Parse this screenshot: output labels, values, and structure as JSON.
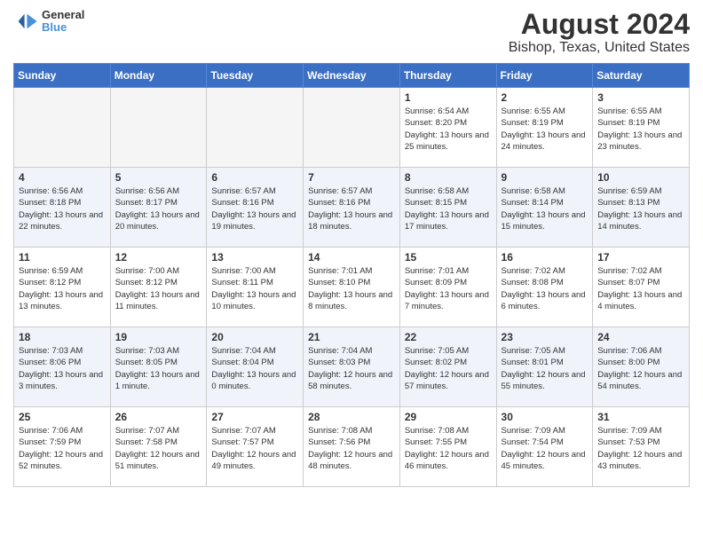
{
  "logo": {
    "line1": "General",
    "line2": "Blue"
  },
  "title": "August 2024",
  "subtitle": "Bishop, Texas, United States",
  "days_of_week": [
    "Sunday",
    "Monday",
    "Tuesday",
    "Wednesday",
    "Thursday",
    "Friday",
    "Saturday"
  ],
  "weeks": [
    [
      {
        "num": "",
        "info": "",
        "empty": true
      },
      {
        "num": "",
        "info": "",
        "empty": true
      },
      {
        "num": "",
        "info": "",
        "empty": true
      },
      {
        "num": "",
        "info": "",
        "empty": true
      },
      {
        "num": "1",
        "info": "Sunrise: 6:54 AM\nSunset: 8:20 PM\nDaylight: 13 hours\nand 25 minutes.",
        "empty": false
      },
      {
        "num": "2",
        "info": "Sunrise: 6:55 AM\nSunset: 8:19 PM\nDaylight: 13 hours\nand 24 minutes.",
        "empty": false
      },
      {
        "num": "3",
        "info": "Sunrise: 6:55 AM\nSunset: 8:19 PM\nDaylight: 13 hours\nand 23 minutes.",
        "empty": false
      }
    ],
    [
      {
        "num": "4",
        "info": "Sunrise: 6:56 AM\nSunset: 8:18 PM\nDaylight: 13 hours\nand 22 minutes.",
        "empty": false
      },
      {
        "num": "5",
        "info": "Sunrise: 6:56 AM\nSunset: 8:17 PM\nDaylight: 13 hours\nand 20 minutes.",
        "empty": false
      },
      {
        "num": "6",
        "info": "Sunrise: 6:57 AM\nSunset: 8:16 PM\nDaylight: 13 hours\nand 19 minutes.",
        "empty": false
      },
      {
        "num": "7",
        "info": "Sunrise: 6:57 AM\nSunset: 8:16 PM\nDaylight: 13 hours\nand 18 minutes.",
        "empty": false
      },
      {
        "num": "8",
        "info": "Sunrise: 6:58 AM\nSunset: 8:15 PM\nDaylight: 13 hours\nand 17 minutes.",
        "empty": false
      },
      {
        "num": "9",
        "info": "Sunrise: 6:58 AM\nSunset: 8:14 PM\nDaylight: 13 hours\nand 15 minutes.",
        "empty": false
      },
      {
        "num": "10",
        "info": "Sunrise: 6:59 AM\nSunset: 8:13 PM\nDaylight: 13 hours\nand 14 minutes.",
        "empty": false
      }
    ],
    [
      {
        "num": "11",
        "info": "Sunrise: 6:59 AM\nSunset: 8:12 PM\nDaylight: 13 hours\nand 13 minutes.",
        "empty": false
      },
      {
        "num": "12",
        "info": "Sunrise: 7:00 AM\nSunset: 8:12 PM\nDaylight: 13 hours\nand 11 minutes.",
        "empty": false
      },
      {
        "num": "13",
        "info": "Sunrise: 7:00 AM\nSunset: 8:11 PM\nDaylight: 13 hours\nand 10 minutes.",
        "empty": false
      },
      {
        "num": "14",
        "info": "Sunrise: 7:01 AM\nSunset: 8:10 PM\nDaylight: 13 hours\nand 8 minutes.",
        "empty": false
      },
      {
        "num": "15",
        "info": "Sunrise: 7:01 AM\nSunset: 8:09 PM\nDaylight: 13 hours\nand 7 minutes.",
        "empty": false
      },
      {
        "num": "16",
        "info": "Sunrise: 7:02 AM\nSunset: 8:08 PM\nDaylight: 13 hours\nand 6 minutes.",
        "empty": false
      },
      {
        "num": "17",
        "info": "Sunrise: 7:02 AM\nSunset: 8:07 PM\nDaylight: 13 hours\nand 4 minutes.",
        "empty": false
      }
    ],
    [
      {
        "num": "18",
        "info": "Sunrise: 7:03 AM\nSunset: 8:06 PM\nDaylight: 13 hours\nand 3 minutes.",
        "empty": false
      },
      {
        "num": "19",
        "info": "Sunrise: 7:03 AM\nSunset: 8:05 PM\nDaylight: 13 hours\nand 1 minute.",
        "empty": false
      },
      {
        "num": "20",
        "info": "Sunrise: 7:04 AM\nSunset: 8:04 PM\nDaylight: 13 hours\nand 0 minutes.",
        "empty": false
      },
      {
        "num": "21",
        "info": "Sunrise: 7:04 AM\nSunset: 8:03 PM\nDaylight: 12 hours\nand 58 minutes.",
        "empty": false
      },
      {
        "num": "22",
        "info": "Sunrise: 7:05 AM\nSunset: 8:02 PM\nDaylight: 12 hours\nand 57 minutes.",
        "empty": false
      },
      {
        "num": "23",
        "info": "Sunrise: 7:05 AM\nSunset: 8:01 PM\nDaylight: 12 hours\nand 55 minutes.",
        "empty": false
      },
      {
        "num": "24",
        "info": "Sunrise: 7:06 AM\nSunset: 8:00 PM\nDaylight: 12 hours\nand 54 minutes.",
        "empty": false
      }
    ],
    [
      {
        "num": "25",
        "info": "Sunrise: 7:06 AM\nSunset: 7:59 PM\nDaylight: 12 hours\nand 52 minutes.",
        "empty": false
      },
      {
        "num": "26",
        "info": "Sunrise: 7:07 AM\nSunset: 7:58 PM\nDaylight: 12 hours\nand 51 minutes.",
        "empty": false
      },
      {
        "num": "27",
        "info": "Sunrise: 7:07 AM\nSunset: 7:57 PM\nDaylight: 12 hours\nand 49 minutes.",
        "empty": false
      },
      {
        "num": "28",
        "info": "Sunrise: 7:08 AM\nSunset: 7:56 PM\nDaylight: 12 hours\nand 48 minutes.",
        "empty": false
      },
      {
        "num": "29",
        "info": "Sunrise: 7:08 AM\nSunset: 7:55 PM\nDaylight: 12 hours\nand 46 minutes.",
        "empty": false
      },
      {
        "num": "30",
        "info": "Sunrise: 7:09 AM\nSunset: 7:54 PM\nDaylight: 12 hours\nand 45 minutes.",
        "empty": false
      },
      {
        "num": "31",
        "info": "Sunrise: 7:09 AM\nSunset: 7:53 PM\nDaylight: 12 hours\nand 43 minutes.",
        "empty": false
      }
    ]
  ]
}
